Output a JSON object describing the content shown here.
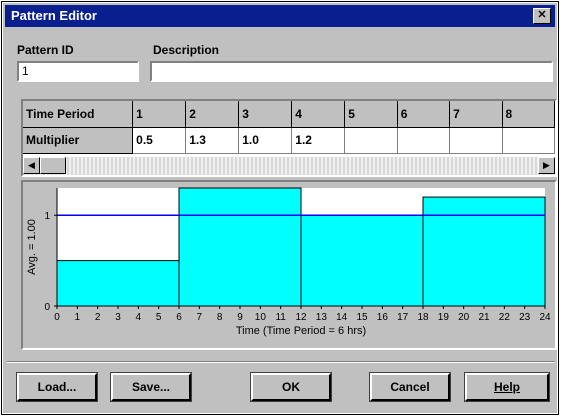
{
  "window": {
    "title": "Pattern Editor",
    "close_label": "✕"
  },
  "form": {
    "pattern_id_label": "Pattern ID",
    "pattern_id_value": "1",
    "description_label": "Description",
    "description_value": ""
  },
  "grid": {
    "row1_header": "Time Period",
    "row2_header": "Multiplier",
    "periods": [
      "1",
      "2",
      "3",
      "4",
      "5",
      "6",
      "7",
      "8"
    ],
    "multipliers": [
      "0.5",
      "1.3",
      "1.0",
      "1.2",
      "",
      "",
      "",
      ""
    ]
  },
  "chart_data": {
    "type": "bar",
    "x": [
      0,
      6,
      12,
      18
    ],
    "values": [
      0.5,
      1.3,
      1.0,
      1.2
    ],
    "bar_width": 6,
    "average": 1.0,
    "ylabel": "Avg. = 1.00",
    "xlabel": "Time (Time Period = 6 hrs)",
    "xticks": [
      "0",
      "1",
      "2",
      "3",
      "4",
      "5",
      "6",
      "7",
      "8",
      "9",
      "10",
      "11",
      "12",
      "13",
      "14",
      "15",
      "16",
      "17",
      "18",
      "19",
      "20",
      "21",
      "22",
      "23",
      "24"
    ],
    "yticks": [
      "0",
      "1"
    ],
    "xlim": [
      0,
      24
    ],
    "ylim": [
      0,
      1.3
    ],
    "bar_color": "#00ffff",
    "avg_line_color": "#0000ff"
  },
  "buttons": {
    "load": "Load...",
    "save": "Save...",
    "ok": "OK",
    "cancel": "Cancel",
    "help": "Help"
  }
}
